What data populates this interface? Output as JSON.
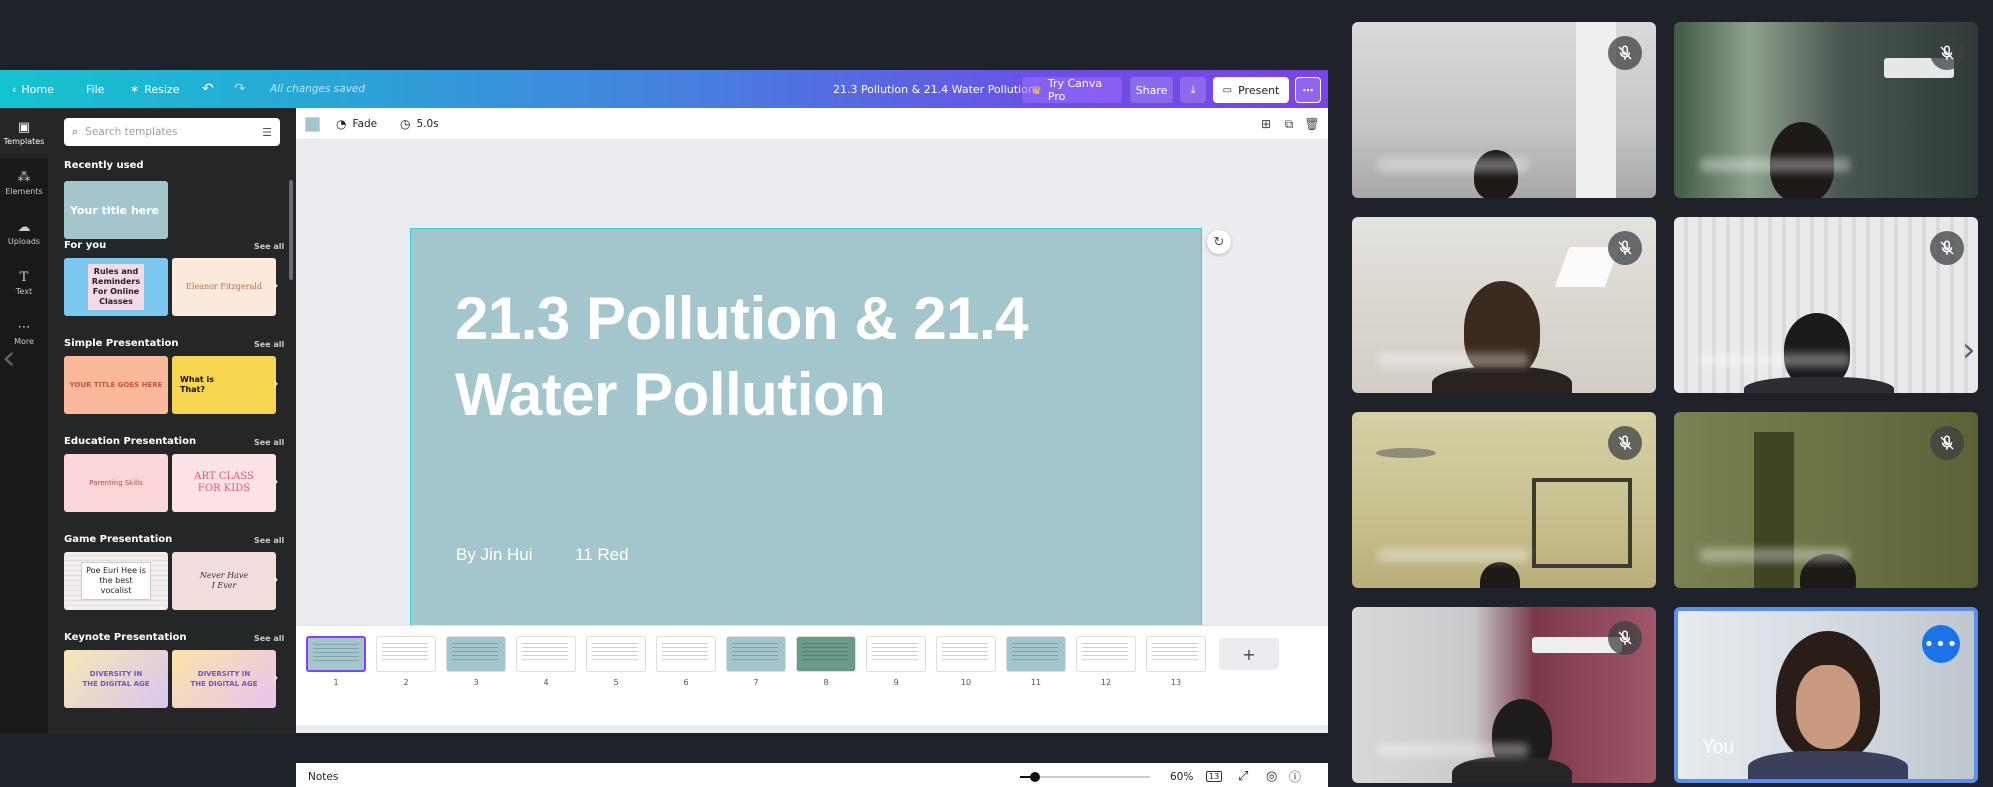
{
  "topbar": {
    "home": "Home",
    "file": "File",
    "resize": "Resize",
    "saved_status": "All changes saved",
    "doc_title": "21.3 Pollution & 21.4 Water Pollution",
    "try_pro": "Try Canva Pro",
    "share": "Share",
    "present": "Present"
  },
  "rail": [
    "Templates",
    "Elements",
    "Uploads",
    "Text",
    "More"
  ],
  "panel": {
    "search_placeholder": "Search templates",
    "recently_used": "Recently used",
    "recent_thumb": "Your title here",
    "see_all": "See all",
    "sections": [
      {
        "title": "For you",
        "thumbs": [
          "Rules and Reminders For Online Classes",
          "Eleanor Fitzgerald"
        ]
      },
      {
        "title": "Simple Presentation",
        "thumbs": [
          "YOUR TITLE GOES HERE",
          "What is That?"
        ]
      },
      {
        "title": "Education Presentation",
        "thumbs": [
          "Parenting Skills",
          "ART CLASS FOR KIDS"
        ]
      },
      {
        "title": "Game Presentation",
        "thumbs": [
          "Poe Euri Hee is the best vocalist",
          "Never Have I Ever"
        ]
      },
      {
        "title": "Keynote Presentation",
        "thumbs": [
          "DIVERSITY IN THE DIGITAL AGE",
          "DIVERSITY IN THE DIGITAL AGE"
        ]
      }
    ]
  },
  "editor": {
    "transition": "Fade",
    "duration": "5.0s",
    "slide_title": "21.3 Pollution & 21.4 Water Pollution",
    "slide_author": "By Jin Hui",
    "slide_class": "11 Red",
    "pages": [
      "1",
      "2",
      "3",
      "4",
      "5",
      "6",
      "7",
      "8",
      "9",
      "10",
      "11",
      "12",
      "13"
    ],
    "notes": "Notes",
    "zoom": "60%",
    "page_count": "13"
  },
  "meeting": {
    "you_label": "You",
    "colors": {
      "accent": "#1a73e8",
      "tile_border": "#5a8ef0"
    }
  }
}
